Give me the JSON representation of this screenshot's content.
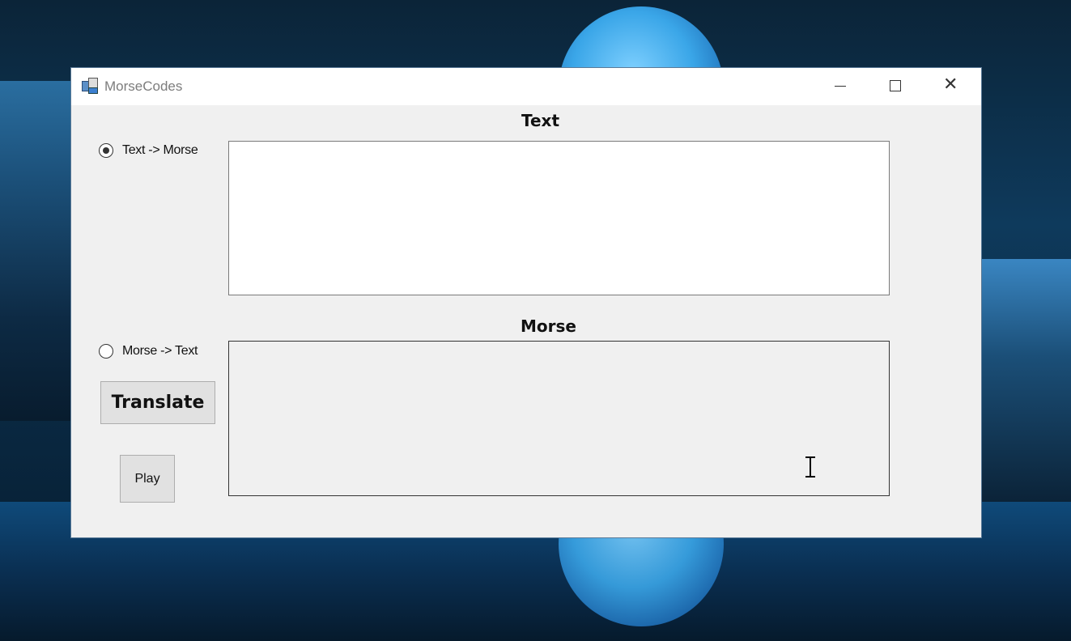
{
  "window": {
    "title": "MorseCodes",
    "controls": [
      "minimize",
      "maximize",
      "close"
    ],
    "close_glyph": "✕"
  },
  "labels": {
    "text_heading": "Text",
    "morse_heading": "Morse"
  },
  "modes": {
    "options": [
      {
        "label": "Text -> Morse",
        "selected": true
      },
      {
        "label": "Morse -> Text",
        "selected": false
      }
    ]
  },
  "inputs": {
    "text_value": "",
    "morse_value": ""
  },
  "buttons": {
    "translate_label": "Translate",
    "play_label": "Play"
  },
  "icons": {
    "app": "app-window-icon",
    "mouse_cursor": "ibeam-cursor-icon"
  }
}
